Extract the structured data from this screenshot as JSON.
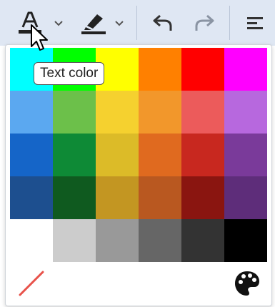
{
  "tooltip": {
    "text": "Text color"
  },
  "toolbar": {
    "text_color_icon": "text-color-icon",
    "highlight_icon": "highlight-color-icon",
    "undo_icon": "undo-icon",
    "redo_icon": "redo-icon",
    "menu_icon": "align-menu-icon",
    "text_color_underline": "#222222"
  },
  "palette": {
    "rows": [
      [
        "#00ffff",
        "#00ff00",
        "#ffff00",
        "#ff8000",
        "#ff0000",
        "#ff00ff"
      ],
      [
        "#5ba8f0",
        "#6cc04a",
        "#f5d12f",
        "#f2972b",
        "#ec5b5b",
        "#b768de"
      ],
      [
        "#1565c8",
        "#0e8a36",
        "#dcbb28",
        "#e06a1f",
        "#c8281f",
        "#7a3a9a"
      ],
      [
        "#1d4f8f",
        "#0f5a1f",
        "#c39622",
        "#b95820",
        "#8a1510",
        "#5e2d7a"
      ],
      [
        "#ffffff",
        "#cccccc",
        "#999999",
        "#666666",
        "#333333",
        "#000000"
      ]
    ],
    "no_color_icon": "no-color-icon",
    "custom_color_icon": "palette-icon"
  }
}
